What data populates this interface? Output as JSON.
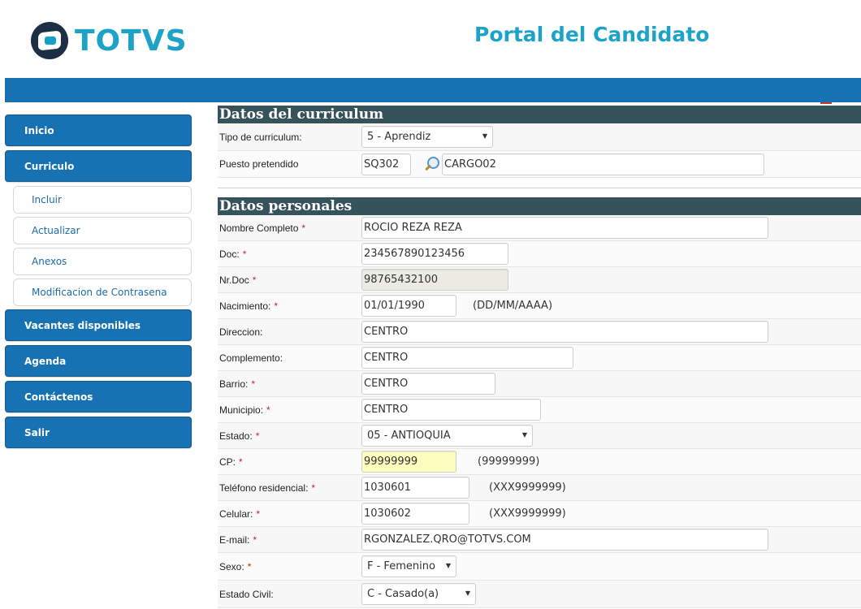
{
  "header": {
    "logo_text": "TOTVS",
    "portal_title": "Portal del Candidato"
  },
  "sidebar": {
    "items": [
      {
        "label": "Inicio",
        "type": "main"
      },
      {
        "label": "Curriculo",
        "type": "main"
      },
      {
        "label": "Incluir",
        "type": "sub"
      },
      {
        "label": "Actualizar",
        "type": "sub"
      },
      {
        "label": "Anexos",
        "type": "sub"
      },
      {
        "label": "Modificacion de Contrasena",
        "type": "sub"
      },
      {
        "label": "Vacantes disponibles",
        "type": "main"
      },
      {
        "label": "Agenda",
        "type": "main"
      },
      {
        "label": "Contáctenos",
        "type": "main"
      },
      {
        "label": "Salir",
        "type": "main"
      }
    ]
  },
  "curriculum": {
    "title": "Datos del curriculum",
    "tipo_label": "Tipo de curriculum:",
    "tipo_value": "5 - Aprendiz",
    "puesto_label": "Puesto pretendido",
    "puesto_code": "SQ302",
    "puesto_desc": "CARGO02"
  },
  "personal": {
    "title": "Datos personales",
    "nombre_label": "Nombre Completo",
    "nombre_value": "ROCIO REZA REZA",
    "doc_label": "Doc:",
    "doc_value": "234567890123456",
    "nrdoc_label": "Nr.Doc",
    "nrdoc_value": "98765432100",
    "nacimiento_label": "Nacimiento:",
    "nacimiento_value": "01/01/1990",
    "nacimiento_hint": "(DD/MM/AAAA)",
    "direccion_label": "Direccion:",
    "direccion_value": "CENTRO",
    "complemento_label": "Complemento:",
    "complemento_value": "CENTRO",
    "barrio_label": "Barrio:",
    "barrio_value": "CENTRO",
    "municipio_label": "Municipio:",
    "municipio_value": "CENTRO",
    "estado_label": "Estado:",
    "estado_value": "05 - ANTIOQUIA",
    "cp_label": "CP:",
    "cp_value": "99999999",
    "cp_hint": "(99999999)",
    "telefono_label": "Teléfono residencial:",
    "telefono_value": "1030601",
    "telefono_hint": "(XXX9999999)",
    "celular_label": "Celular:",
    "celular_value": "1030602",
    "celular_hint": "(XXX9999999)",
    "email_label": "E-mail:",
    "email_value": "RGONZALEZ.QRO@TOTVS.COM",
    "sexo_label": "Sexo:",
    "sexo_value": "F - Femenino",
    "civil_label": "Estado Civil:",
    "civil_value": "C - Casado(a)"
  },
  "required_mark": "*"
}
